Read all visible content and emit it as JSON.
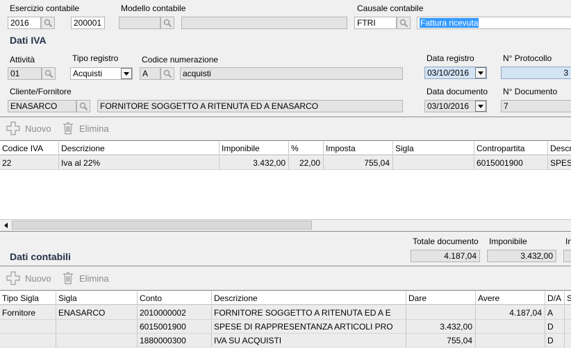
{
  "header": {
    "esercizio_label": "Esercizio contabile",
    "esercizio_year": "2016",
    "esercizio_code": "200001",
    "modello_label": "Modello contabile",
    "modello_code": "",
    "modello_desc": "",
    "causale_label": "Causale contabile",
    "causale_code": "FTRI",
    "causale_desc": "Fattura ricevuta"
  },
  "iva": {
    "title": "Dati IVA",
    "attivita_label": "Attività",
    "attivita_value": "01",
    "tipo_registro_label": "Tipo registro",
    "tipo_registro_value": "Acquisti",
    "codice_numerazione_label": "Codice numerazione",
    "codice_numerazione_code": "A",
    "codice_numerazione_desc": "acquisti",
    "data_registro_label": "Data registro",
    "data_registro_value": "03/10/2016",
    "protocollo_label": "N° Protocollo",
    "protocollo_value": "3",
    "cliente_label": "Cliente/Fornitore",
    "cliente_code": "ENASARCO",
    "cliente_desc": "FORNITORE SOGGETTO A RITENUTA ED A ENASARCO",
    "data_documento_label": "Data documento",
    "data_documento_value": "03/10/2016",
    "numero_documento_label": "N° Documento",
    "numero_documento_value": "7"
  },
  "toolbar1": {
    "nuovo": "Nuovo",
    "elimina": "Elimina"
  },
  "iva_table": {
    "headers": [
      "Codice IVA",
      "Descrizione",
      "Imponibile",
      "%",
      "Imposta",
      "Sigla",
      "Contropartita",
      "Descr"
    ],
    "rows": [
      [
        "22",
        "Iva al 22%",
        "3.432,00",
        "22,00",
        "755,04",
        "",
        "6015001900",
        "SPES"
      ]
    ]
  },
  "totals": {
    "totale_documento_label": "Totale documento",
    "totale_documento_value": "4.187,04",
    "imponibile_label": "Imponibile",
    "imponibile_value": "3.432,00",
    "imposta_label": "In"
  },
  "contabili": {
    "title": "Dati contabili"
  },
  "toolbar2": {
    "nuovo": "Nuovo",
    "elimina": "Elimina"
  },
  "cont_table": {
    "headers": [
      "Tipo Sigla",
      "Sigla",
      "Conto",
      "Descrizione",
      "Dare",
      "Avere",
      "D/A",
      "S"
    ],
    "rows": [
      [
        "Fornitore",
        "ENASARCO",
        "2010000002",
        "FORNITORE SOGGETTO A RITENUTA ED A E",
        "",
        "4.187,04",
        "A",
        ""
      ],
      [
        "",
        "",
        "6015001900",
        "SPESE DI RAPPRESENTANZA ARTICOLI PRO",
        "3.432,00",
        "",
        "D",
        ""
      ],
      [
        "",
        "",
        "1880000300",
        "IVA SU ACQUISTI",
        "755,04",
        "",
        "D",
        ""
      ]
    ]
  },
  "colors": {
    "title": "#26324a",
    "selection": "#3399ff",
    "highlight_field": "#d3e4f5"
  }
}
